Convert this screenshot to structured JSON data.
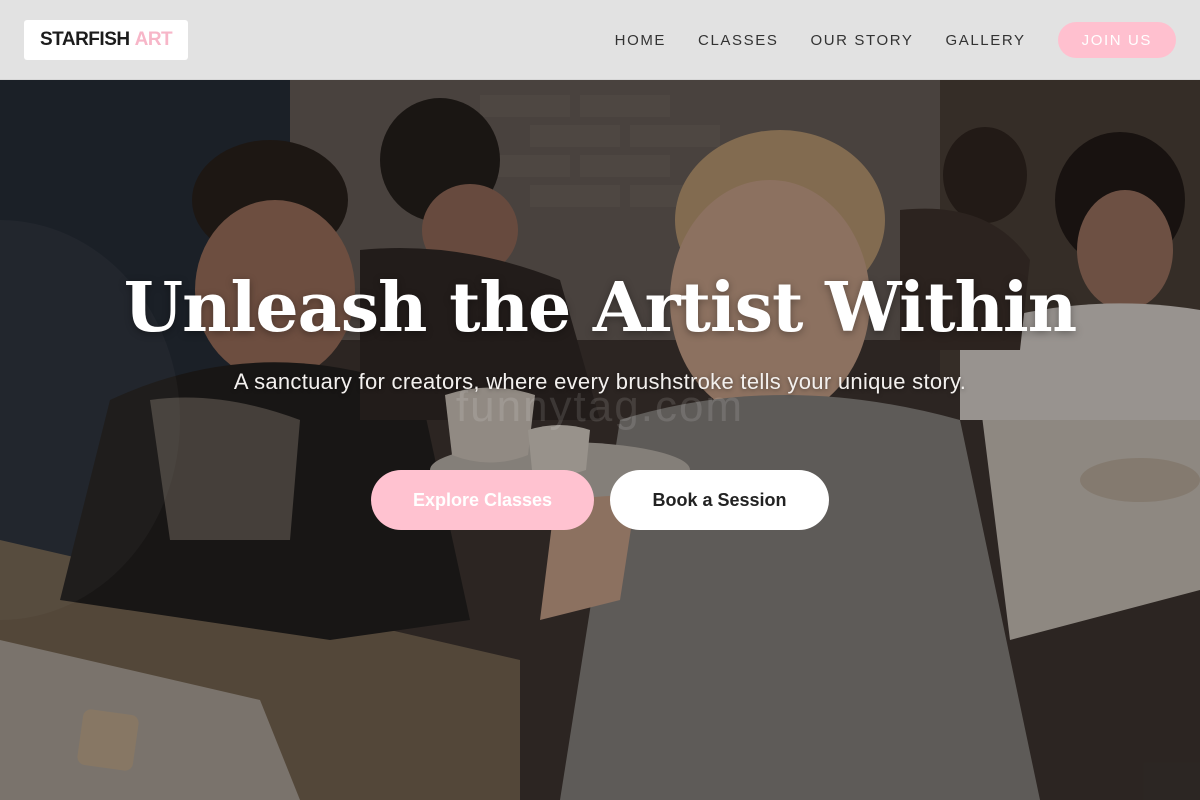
{
  "brand": {
    "name_part1": "STARFISH",
    "name_part2": "ART",
    "accent_color": "#f7b6c8"
  },
  "nav": {
    "items": [
      {
        "label": "HOME"
      },
      {
        "label": "CLASSES"
      },
      {
        "label": "OUR STORY"
      },
      {
        "label": "GALLERY"
      }
    ],
    "cta_label": "JOIN US",
    "cta_color": "#ffc0cf"
  },
  "hero": {
    "title": "Unleash the Artist Within",
    "subtitle": "A sanctuary for creators, where every brushstroke tells your unique story.",
    "watermark": "funnytag.com",
    "primary_button": "Explore Classes",
    "secondary_button": "Book a Session",
    "background_image": "pottery-class-photo"
  }
}
